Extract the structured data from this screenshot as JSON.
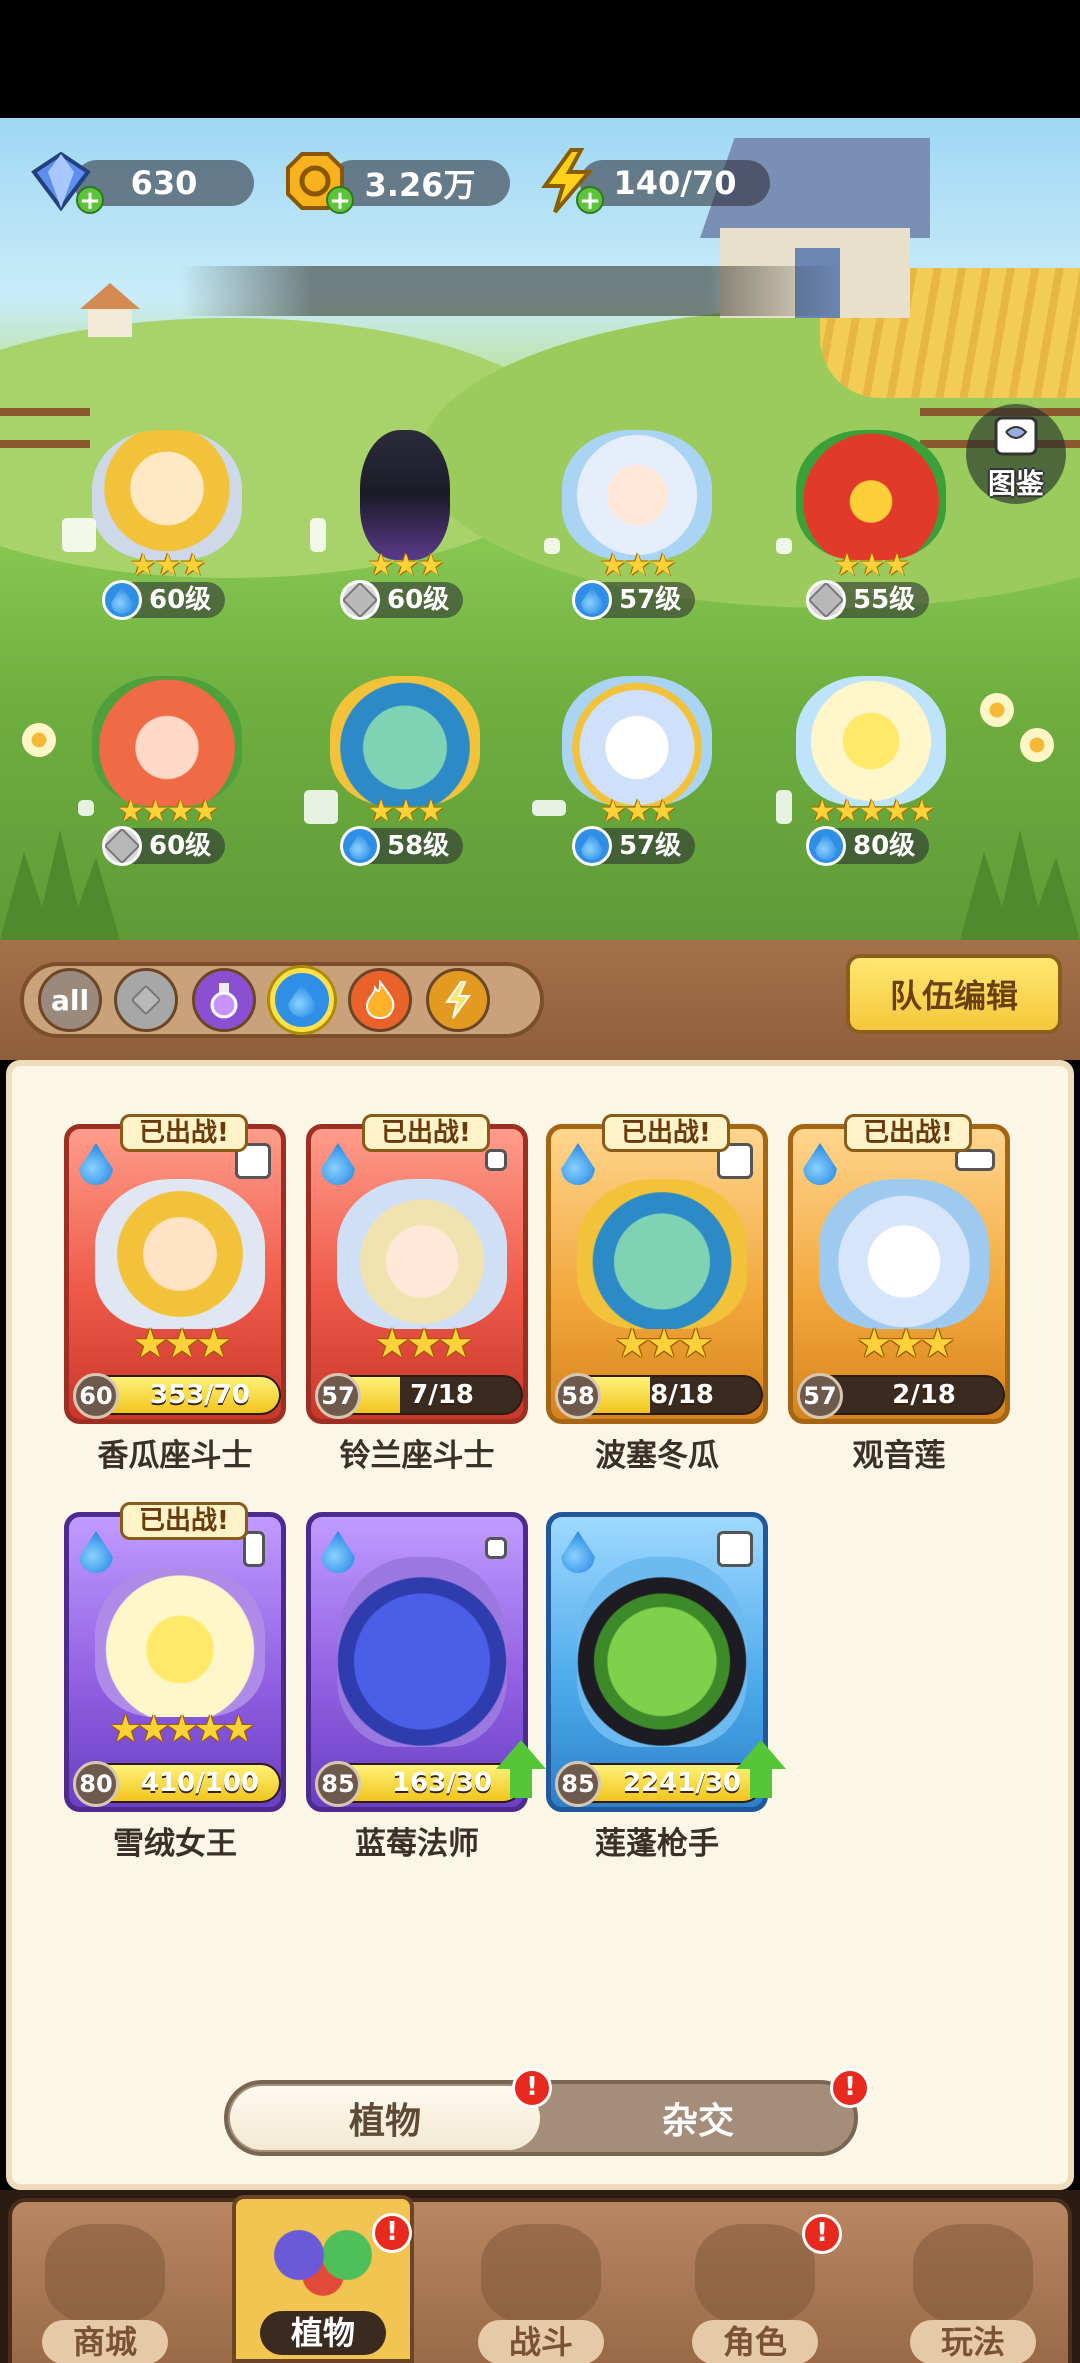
{
  "resources": {
    "gems": "630",
    "coins": "3.26万",
    "energy": "140/70"
  },
  "codex_label": "图鉴",
  "team": [
    {
      "stars": "★★★",
      "level": "60级",
      "type": "water"
    },
    {
      "stars": "★★★",
      "level": "60级",
      "type": "sword"
    },
    {
      "stars": "★★★",
      "level": "57级",
      "type": "water"
    },
    {
      "stars": "★★★",
      "level": "55级",
      "type": "sword"
    },
    {
      "stars": "★★★★",
      "level": "60级",
      "type": "sword"
    },
    {
      "stars": "★★★",
      "level": "58级",
      "type": "water"
    },
    {
      "stars": "★★★",
      "level": "57级",
      "type": "water"
    },
    {
      "stars": "★★★★★",
      "level": "80级",
      "type": "water"
    }
  ],
  "filters": [
    {
      "label": "all",
      "icon": "all-icon"
    },
    {
      "label": "",
      "icon": "sword-icon"
    },
    {
      "label": "",
      "icon": "potion-icon"
    },
    {
      "label": "",
      "icon": "water-drop-icon"
    },
    {
      "label": "",
      "icon": "fire-icon"
    },
    {
      "label": "",
      "icon": "lightning-icon"
    }
  ],
  "team_edit_label": "队伍编辑",
  "deployed_label": "已出战!",
  "cards": [
    {
      "name": "香瓜座斗士",
      "level": "60",
      "progress": "353/70",
      "fill": 1.0,
      "stars": "★★★",
      "rarity": "red",
      "deployed": true,
      "upgrade": false
    },
    {
      "name": "铃兰座斗士",
      "level": "57",
      "progress": "7/18",
      "fill": 0.39,
      "stars": "★★★",
      "rarity": "red",
      "deployed": true,
      "upgrade": false
    },
    {
      "name": "波塞冬瓜",
      "level": "58",
      "progress": "8/18",
      "fill": 0.44,
      "stars": "★★★",
      "rarity": "gold",
      "deployed": true,
      "upgrade": false
    },
    {
      "name": "观音莲",
      "level": "57",
      "progress": "2/18",
      "fill": 0.11,
      "stars": "★★★",
      "rarity": "gold",
      "deployed": true,
      "upgrade": false
    },
    {
      "name": "雪绒女王",
      "level": "80",
      "progress": "410/100",
      "fill": 1.0,
      "stars": "★★★★★",
      "rarity": "purple",
      "deployed": true,
      "upgrade": false
    },
    {
      "name": "蓝莓法师",
      "level": "85",
      "progress": "163/30",
      "fill": 1.0,
      "stars": "",
      "rarity": "purple",
      "deployed": false,
      "upgrade": true
    },
    {
      "name": "莲蓬枪手",
      "level": "85",
      "progress": "2241/30",
      "fill": 1.0,
      "stars": "",
      "rarity": "blue",
      "deployed": false,
      "upgrade": true
    }
  ],
  "segments": {
    "plants": "植物",
    "hybrid": "杂交"
  },
  "alert_mark": "!",
  "nav": [
    {
      "label": "商城",
      "active": false,
      "alert": false
    },
    {
      "label": "植物",
      "active": true,
      "alert": true
    },
    {
      "label": "战斗",
      "active": false,
      "alert": false
    },
    {
      "label": "角色",
      "active": false,
      "alert": true
    },
    {
      "label": "玩法",
      "active": false,
      "alert": false
    }
  ],
  "colors": {
    "accent_gold": "#f5c73a",
    "wood": "#9a6a48",
    "paper": "#fbf6e6",
    "alert_red": "#e8291e",
    "upgrade_green": "#55c637"
  }
}
